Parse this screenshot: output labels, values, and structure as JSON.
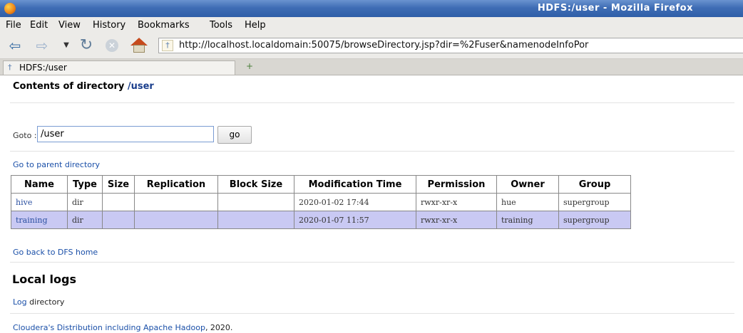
{
  "window": {
    "title": "HDFS:/user - Mozilla Firefox"
  },
  "menu": [
    "File",
    "Edit",
    "View",
    "History",
    "Bookmarks",
    "Tools",
    "Help"
  ],
  "toolbar": {
    "url": "http://localhost.localdomain:50075/browseDirectory.jsp?dir=%2Fuser&namenodeInfoPor"
  },
  "tab": {
    "label": "HDFS:/user",
    "new_tab_glyph": "+"
  },
  "page": {
    "heading_prefix": "Contents of directory ",
    "heading_dir": "/user",
    "goto_label": "Goto :",
    "goto_value": "/user",
    "go_label": "go",
    "parent_link": "Go to parent directory",
    "table": {
      "headers": [
        "Name",
        "Type",
        "Size",
        "Replication",
        "Block Size",
        "Modification Time",
        "Permission",
        "Owner",
        "Group"
      ],
      "rows": [
        [
          "hive",
          "dir",
          "",
          "",
          "",
          "2020-01-02 17:44",
          "rwxr-xr-x",
          "hue",
          "supergroup"
        ],
        [
          "training",
          "dir",
          "",
          "",
          "",
          "2020-01-07 11:57",
          "rwxr-xr-x",
          "training",
          "supergroup"
        ]
      ]
    },
    "dfs_home_link": "Go back to DFS home",
    "local_logs_heading": "Local logs",
    "log_link": "Log",
    "log_text": " directory",
    "footer_link": "Cloudera's Distribution including Apache Hadoop",
    "footer_text": ", 2020."
  }
}
